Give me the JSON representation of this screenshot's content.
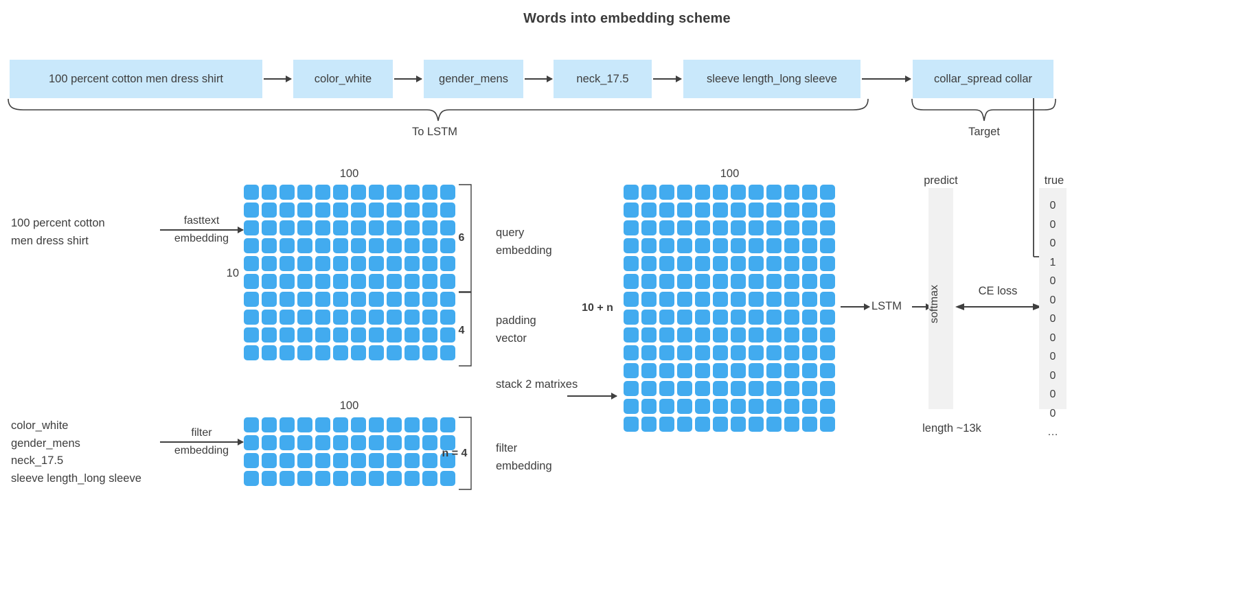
{
  "title": "Words into embedding scheme",
  "top_sequence": {
    "boxes": [
      "100 percent cotton men dress shirt",
      "color_white",
      "gender_mens",
      "neck_17.5",
      "sleeve length_long sleeve",
      "collar_spread collar"
    ],
    "brace_to_lstm": "To LSTM",
    "brace_target": "Target"
  },
  "query_branch": {
    "source_text": "100 percent cotton\nmen dress shirt",
    "arrow_top": "fasttext",
    "arrow_bottom": "embedding",
    "rows_label": "10",
    "cols_label": "100",
    "bracket_query_rows": "6",
    "bracket_padding_rows": "4",
    "query_label": "query\nembedding",
    "padding_label": "padding\nvector"
  },
  "filter_branch": {
    "source_text": "color_white\ngender_mens\nneck_17.5\nsleeve length_long sleeve",
    "arrow_top": "filter",
    "arrow_bottom": "embedding",
    "cols_label": "100",
    "rows_label": "n = 4",
    "filter_label": "filter\nembedding"
  },
  "stack": {
    "label": "stack 2 matrixes",
    "cols_label": "100",
    "rows_label": "10 + n"
  },
  "model": {
    "lstm_label": "LSTM",
    "softmax_label": "softmax",
    "predict_label": "predict",
    "ce_loss_label": "CE loss",
    "true_label": "true",
    "length_label": "length ~13k",
    "true_vector": [
      "0",
      "0",
      "0",
      "1",
      "0",
      "0",
      "0",
      "0",
      "0",
      "0",
      "0",
      "0",
      "…"
    ]
  },
  "colors": {
    "cell_blue": "#42ABEF",
    "box_blue": "#c9e8fb",
    "bar_gray": "#f1f1f1",
    "ink": "#3d3d3d"
  },
  "chart_data": {
    "type": "diagram",
    "matrices": [
      {
        "name": "query + padding matrix",
        "cols": 100,
        "rows": 10,
        "query_rows": 6,
        "padding_rows": 4,
        "drawn_cols": 12,
        "drawn_rows": 10
      },
      {
        "name": "filter embedding matrix",
        "cols": 100,
        "rows": 4,
        "drawn_cols": 12,
        "drawn_rows": 4
      },
      {
        "name": "stacked matrix",
        "cols": 100,
        "rows": "10 + n",
        "drawn_cols": 12,
        "drawn_rows": 14
      }
    ]
  }
}
